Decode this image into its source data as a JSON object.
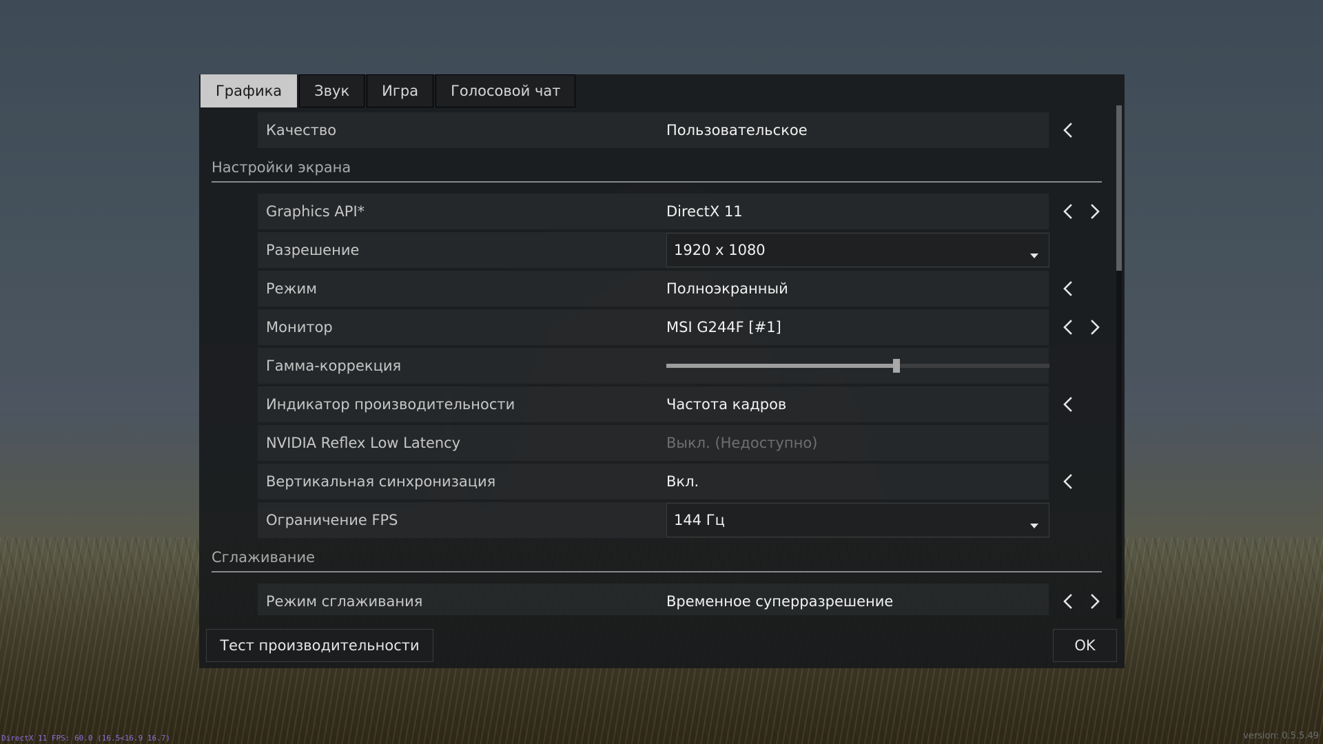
{
  "tabs": [
    {
      "label": "Графика",
      "active": true
    },
    {
      "label": "Звук",
      "active": false
    },
    {
      "label": "Игра",
      "active": false
    },
    {
      "label": "Голосовой чат",
      "active": false
    }
  ],
  "quality": {
    "label": "Качество",
    "value": "Пользовательское"
  },
  "sections": {
    "screen": "Настройки экрана",
    "antialiasing": "Сглаживание"
  },
  "settings": {
    "graphics_api": {
      "label": "Graphics API*",
      "value": "DirectX 11"
    },
    "resolution": {
      "label": "Разрешение",
      "value": "1920 x 1080"
    },
    "mode": {
      "label": "Режим",
      "value": "Полноэкранный"
    },
    "monitor": {
      "label": "Монитор",
      "value": "MSI G244F [#1]"
    },
    "gamma": {
      "label": "Гамма-коррекция",
      "level": 0.6
    },
    "perf_indicator": {
      "label": "Индикатор производительности",
      "value": "Частота кадров"
    },
    "reflex": {
      "label": "NVIDIA Reflex Low Latency",
      "value": "Выкл. (Недоступно)"
    },
    "vsync": {
      "label": "Вертикальная синхронизация",
      "value": "Вкл."
    },
    "fps_limit": {
      "label": "Ограничение FPS",
      "value": "144 Гц"
    },
    "aa_mode": {
      "label": "Режим сглаживания",
      "value": "Временное суперразрешение"
    }
  },
  "buttons": {
    "benchmark": "Тест производительности",
    "ok": "OK"
  },
  "overlay": {
    "fps": "DirectX 11 FPS: 60.0 (16.5<16.9 16.7)",
    "version": "version: 0.5.5.49"
  },
  "icons": {
    "prev": "chevron-left-icon",
    "next": "chevron-right-icon",
    "caret": "caret-down-icon"
  }
}
